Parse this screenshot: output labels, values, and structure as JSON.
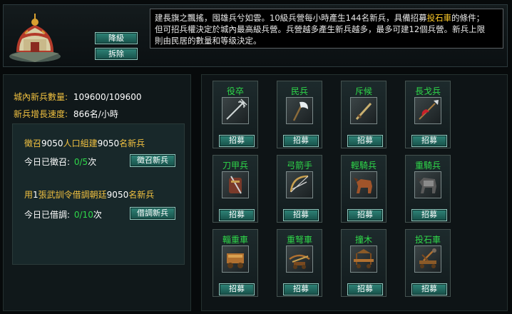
{
  "top": {
    "downgrade_label": "降級",
    "demolish_label": "拆除",
    "desc": {
      "p1": "建長旗之飄搖，囤雄兵兮如雲。10級兵營每小時產生144名新兵，具備招募",
      "p1_highlight": "投石車",
      "p1_end": "的條件；",
      "p2": "但可招兵權決定於城內最高級兵營。兵營越多產生新兵越多，最多可建12個兵營。新兵上限",
      "p3": "則由民居的數量和等级決定。"
    }
  },
  "left": {
    "recruits_label": "城內新兵數量:",
    "recruits_value": "109600/109600",
    "growth_label": "新兵增長速度:",
    "growth_value": "866名/小時",
    "conscript": {
      "line_a": "徵召",
      "line_b": "9050",
      "line_c": "人口組建",
      "line_d": "9050",
      "line_e": "名新兵",
      "today_label": "今日已徵召:",
      "count": "0/5",
      "unit": "次",
      "button": "徵召新兵"
    },
    "borrow": {
      "line_a": "用",
      "line_b": "1",
      "line_c": "張武訓令借調朝廷",
      "line_d": "9050",
      "line_e": "名新兵",
      "today_label": "今日已借調:",
      "count": "0/10",
      "unit": "次",
      "button": "借調新兵"
    }
  },
  "units": [
    {
      "name": "役卒",
      "icon": "trident-icon",
      "button": "招募"
    },
    {
      "name": "民兵",
      "icon": "axe-icon",
      "button": "招募"
    },
    {
      "name": "斥候",
      "icon": "dagger-icon",
      "button": "招募"
    },
    {
      "name": "長戈兵",
      "icon": "spear-icon",
      "button": "招募"
    },
    {
      "name": "刀甲兵",
      "icon": "armor-icon",
      "button": "招募"
    },
    {
      "name": "弓箭手",
      "icon": "bow-icon",
      "button": "招募"
    },
    {
      "name": "輕騎兵",
      "icon": "horse-icon",
      "button": "招募"
    },
    {
      "name": "重騎兵",
      "icon": "armored-horse-icon",
      "button": "招募"
    },
    {
      "name": "輜重車",
      "icon": "supply-cart-icon",
      "button": "招募"
    },
    {
      "name": "重弩車",
      "icon": "ballista-icon",
      "button": "招募"
    },
    {
      "name": "撞木",
      "icon": "battering-ram-icon",
      "button": "招募"
    },
    {
      "name": "投石車",
      "icon": "catapult-icon",
      "button": "招募"
    }
  ]
}
